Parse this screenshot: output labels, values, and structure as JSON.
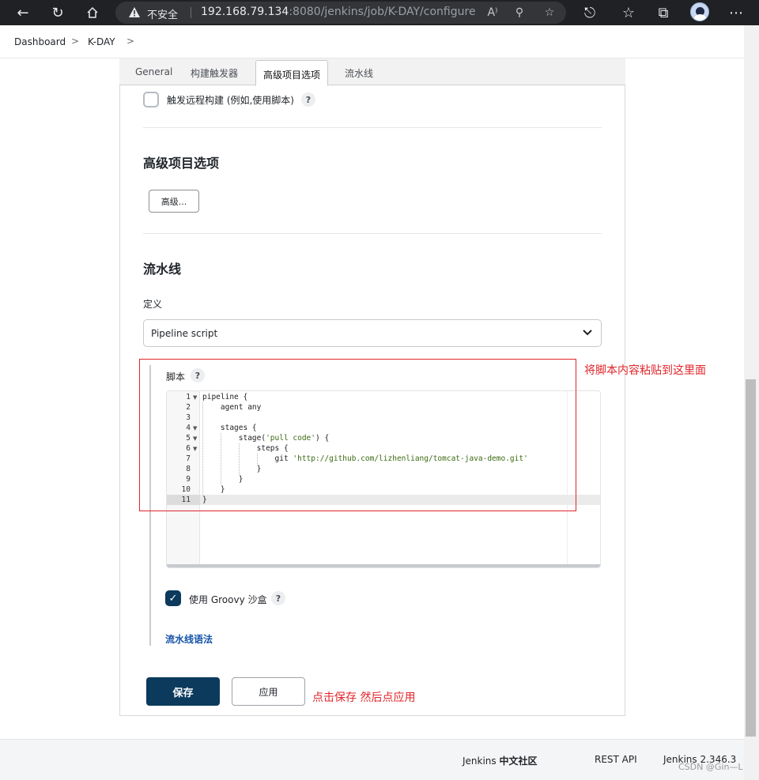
{
  "browser": {
    "security_label": "不安全",
    "url_host": "192.168.79.134",
    "url_rest": ":8080/jenkins/job/K-DAY/configure"
  },
  "breadcrumb": {
    "items": [
      "Dashboard",
      "K-DAY"
    ],
    "separator": ">"
  },
  "tabs": [
    {
      "label": "General"
    },
    {
      "label": "构建触发器"
    },
    {
      "label": "高级项目选项"
    },
    {
      "label": "流水线"
    }
  ],
  "trigger": {
    "remote_build_label": "触发远程构建 (例如,使用脚本)",
    "help": "?"
  },
  "advanced": {
    "title": "高级项目选项",
    "button_label": "高级..."
  },
  "pipeline": {
    "title": "流水线",
    "definition_label": "定义",
    "definition_value": "Pipeline script",
    "script_label": "脚本",
    "help": "?",
    "code_lines": [
      {
        "no": "1",
        "fold": true,
        "text": "pipeline {"
      },
      {
        "no": "2",
        "fold": false,
        "text": "    agent any"
      },
      {
        "no": "3",
        "fold": false,
        "text": ""
      },
      {
        "no": "4",
        "fold": true,
        "text": "    stages {"
      },
      {
        "no": "5",
        "fold": true,
        "text": "        stage('pull code') {"
      },
      {
        "no": "6",
        "fold": true,
        "text": "            steps {"
      },
      {
        "no": "7",
        "fold": false,
        "text": "                git 'http://github.com/lizhenliang/tomcat-java-demo.git'"
      },
      {
        "no": "8",
        "fold": false,
        "text": "            }"
      },
      {
        "no": "9",
        "fold": false,
        "text": "        }"
      },
      {
        "no": "10",
        "fold": false,
        "text": "    }"
      },
      {
        "no": "11",
        "fold": false,
        "text": "}"
      }
    ],
    "groovy_sandbox_label": "使用 Groovy 沙盒",
    "groovy_sandbox_checked": true,
    "syntax_link": "流水线语法"
  },
  "actions": {
    "save_label": "保存",
    "apply_label": "应用"
  },
  "annotations": {
    "paste_hint": "将脚本内容粘贴到这里面",
    "save_hint": "点击保存 然后点应用",
    "color": "#e0252a"
  },
  "footer": {
    "community_prefix": "Jenkins ",
    "community_bold": "中文社区",
    "rest_api": "REST API",
    "version": "Jenkins 2.346.3"
  },
  "watermark": "CSDN @Gin—L",
  "colors": {
    "primary": "#0b3a5c",
    "link": "#1452a8"
  }
}
